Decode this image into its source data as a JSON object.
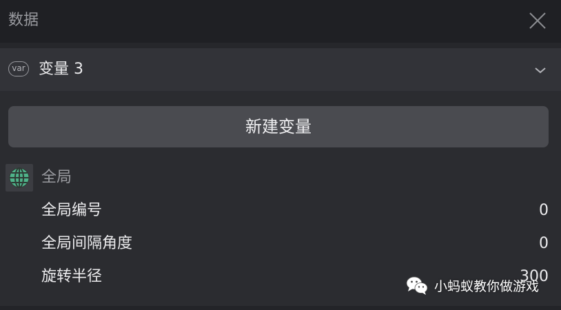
{
  "header": {
    "title": "数据"
  },
  "selector": {
    "icon_text": "var",
    "label": "变量 3"
  },
  "actions": {
    "new_variable": "新建变量"
  },
  "section": {
    "title": "全局",
    "variables": [
      {
        "name": "全局编号",
        "value": "0"
      },
      {
        "name": "全局间隔角度",
        "value": "0"
      },
      {
        "name": "旋转半径",
        "value": "300"
      }
    ]
  },
  "watermark": {
    "text": "小蚂蚁教你做游戏"
  },
  "colors": {
    "panel_bg": "#2b2c30",
    "header_bg": "#1f2024",
    "selector_bg": "#323338",
    "button_bg": "#4a4b50",
    "globe_green": "#4fb38a"
  }
}
